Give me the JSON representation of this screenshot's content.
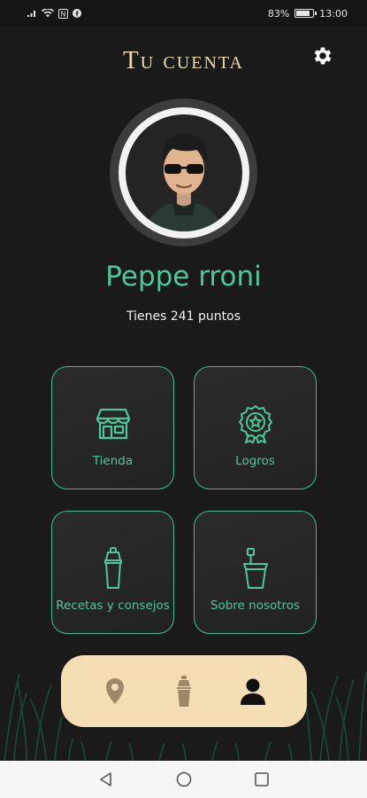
{
  "status_bar": {
    "battery_percent": "83%",
    "time": "13:00"
  },
  "header": {
    "title": "Tu cuenta"
  },
  "profile": {
    "name": "Peppe rroni",
    "points_text": "Tienes 241 puntos"
  },
  "tiles": [
    {
      "label": "Tienda",
      "icon": "store-icon"
    },
    {
      "label": "Logros",
      "icon": "award-badge-icon"
    },
    {
      "label": "Recetas y consejos",
      "icon": "cocktail-shaker-icon"
    },
    {
      "label": "Sobre nosotros",
      "icon": "cup-icon"
    }
  ],
  "bottom_nav": [
    {
      "icon": "location-pin-icon",
      "active": false
    },
    {
      "icon": "cocktail-shaker-icon",
      "active": false
    },
    {
      "icon": "user-icon",
      "active": true
    }
  ],
  "colors": {
    "background": "#1a1a1a",
    "accent": "#4ec79a",
    "title": "#eedcae",
    "nav_bar": "#f3dfb3"
  }
}
